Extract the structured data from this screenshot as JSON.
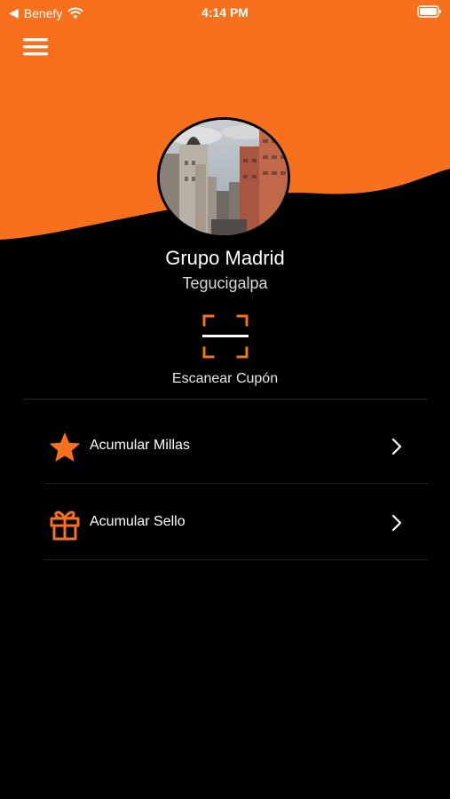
{
  "colors": {
    "accent": "#F7701E",
    "background": "#000000"
  },
  "status_bar": {
    "carrier": "Benefy",
    "time": "4:14 PM"
  },
  "header": {
    "menu_icon": "hamburger-icon"
  },
  "profile": {
    "name": "Grupo Madrid",
    "location": "Tegucigalpa"
  },
  "scan": {
    "label": "Escanear Cupón",
    "icon": "qr-scan-icon"
  },
  "menu": {
    "items": [
      {
        "label": "Acumular Millas",
        "icon": "star-icon"
      },
      {
        "label": "Acumular Sello",
        "icon": "gift-icon"
      }
    ]
  }
}
